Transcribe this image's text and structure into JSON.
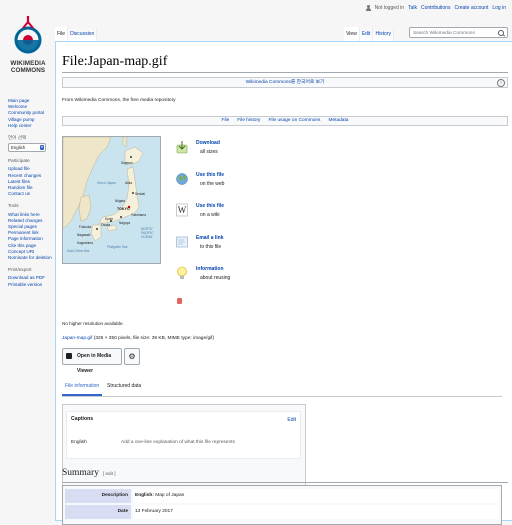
{
  "userbar": {
    "not_logged_in": "Not logged in",
    "links": [
      "Talk",
      "Contributions",
      "Create account",
      "Log in"
    ]
  },
  "logo": {
    "line1": "WIKIMEDIA",
    "line2": "COMMONS"
  },
  "sidebar": {
    "main": [
      "Main page",
      "Welcome",
      "Community portal",
      "Village pump",
      "Help center"
    ],
    "lang_heading": "언어 선택",
    "lang_value": "English",
    "participate_heading": "Participate",
    "participate": [
      "Upload file",
      "Recent changes",
      "Latest files",
      "Random file",
      "Contact us"
    ],
    "tools_heading": "Tools",
    "tools": [
      "What links here",
      "Related changes",
      "Special pages",
      "Permanent link",
      "Page information",
      "Cite this page",
      "Concept URI",
      "Nominate for deletion"
    ],
    "print_heading": "Print/export",
    "print": [
      "Download as PDF",
      "Printable version"
    ]
  },
  "tabs": {
    "left": [
      "File",
      "Discussion"
    ],
    "right": [
      "View",
      "Edit",
      "History"
    ],
    "search_placeholder": "Search Wikimedia Commons"
  },
  "page": {
    "title": "File:Japan-map.gif",
    "langbar": "Wikimedia Commons를 한국어로 보기",
    "langbar_help": "?",
    "from": "From Wikimedia Commons, the free media repository",
    "filetoc": [
      "File",
      "File history",
      "File usage on Commons",
      "Metadata"
    ]
  },
  "map_labels": {
    "sapporo": "Sapporo",
    "sea_of_japan": "Sea of Japan",
    "akita": "Akita",
    "sendai": "Sendai",
    "niigata": "Niigata",
    "tokyo": "TOKYO",
    "yokohama": "Yokohama",
    "north_pacific": "NORTH PACIFIC OCEAN",
    "nagoya": "Nagoya",
    "kyoto": "Kyoto",
    "osaka": "Osaka",
    "fukuoka": "Fukuoka",
    "nagasaki": "Nagasaki",
    "kagoshima": "Kagoshima",
    "philippine_sea": "Philippine Sea",
    "east_china_sea": "East China Sea"
  },
  "actions": [
    {
      "icon": "download-icon",
      "l1": "Download",
      "l2": "all sizes"
    },
    {
      "icon": "globe-icon",
      "l1": "Use this file",
      "l2": "on the web"
    },
    {
      "icon": "wiki-icon",
      "l1": "Use this file",
      "l2": "on a wiki"
    },
    {
      "icon": "email-icon",
      "l1": "Email a link",
      "l2": "to this file"
    },
    {
      "icon": "lightbulb-icon",
      "l1": "Information",
      "l2": "about reusing"
    }
  ],
  "file": {
    "no_higher": "No higher resolution available.",
    "name": "Japan-map.gif",
    "info": " (326 × 350 pixels, file size: 39 KB, MIME type: image/gif)",
    "media_viewer": "Open in Media Viewer",
    "gear": "⚙"
  },
  "structured": {
    "tabs": [
      "File information",
      "Structured data"
    ],
    "captions_title": "Captions",
    "edit": "Edit",
    "lang": "English",
    "placeholder": "Add a one-line explanation of what this file represents"
  },
  "summary": {
    "title": "Summary",
    "edit": "[ edit ]",
    "rows": [
      {
        "k": "Description",
        "v_lang": "English:",
        "v": " Map of Japan"
      },
      {
        "k": "Date",
        "v_lang": "",
        "v": "13 February 2017"
      }
    ]
  }
}
